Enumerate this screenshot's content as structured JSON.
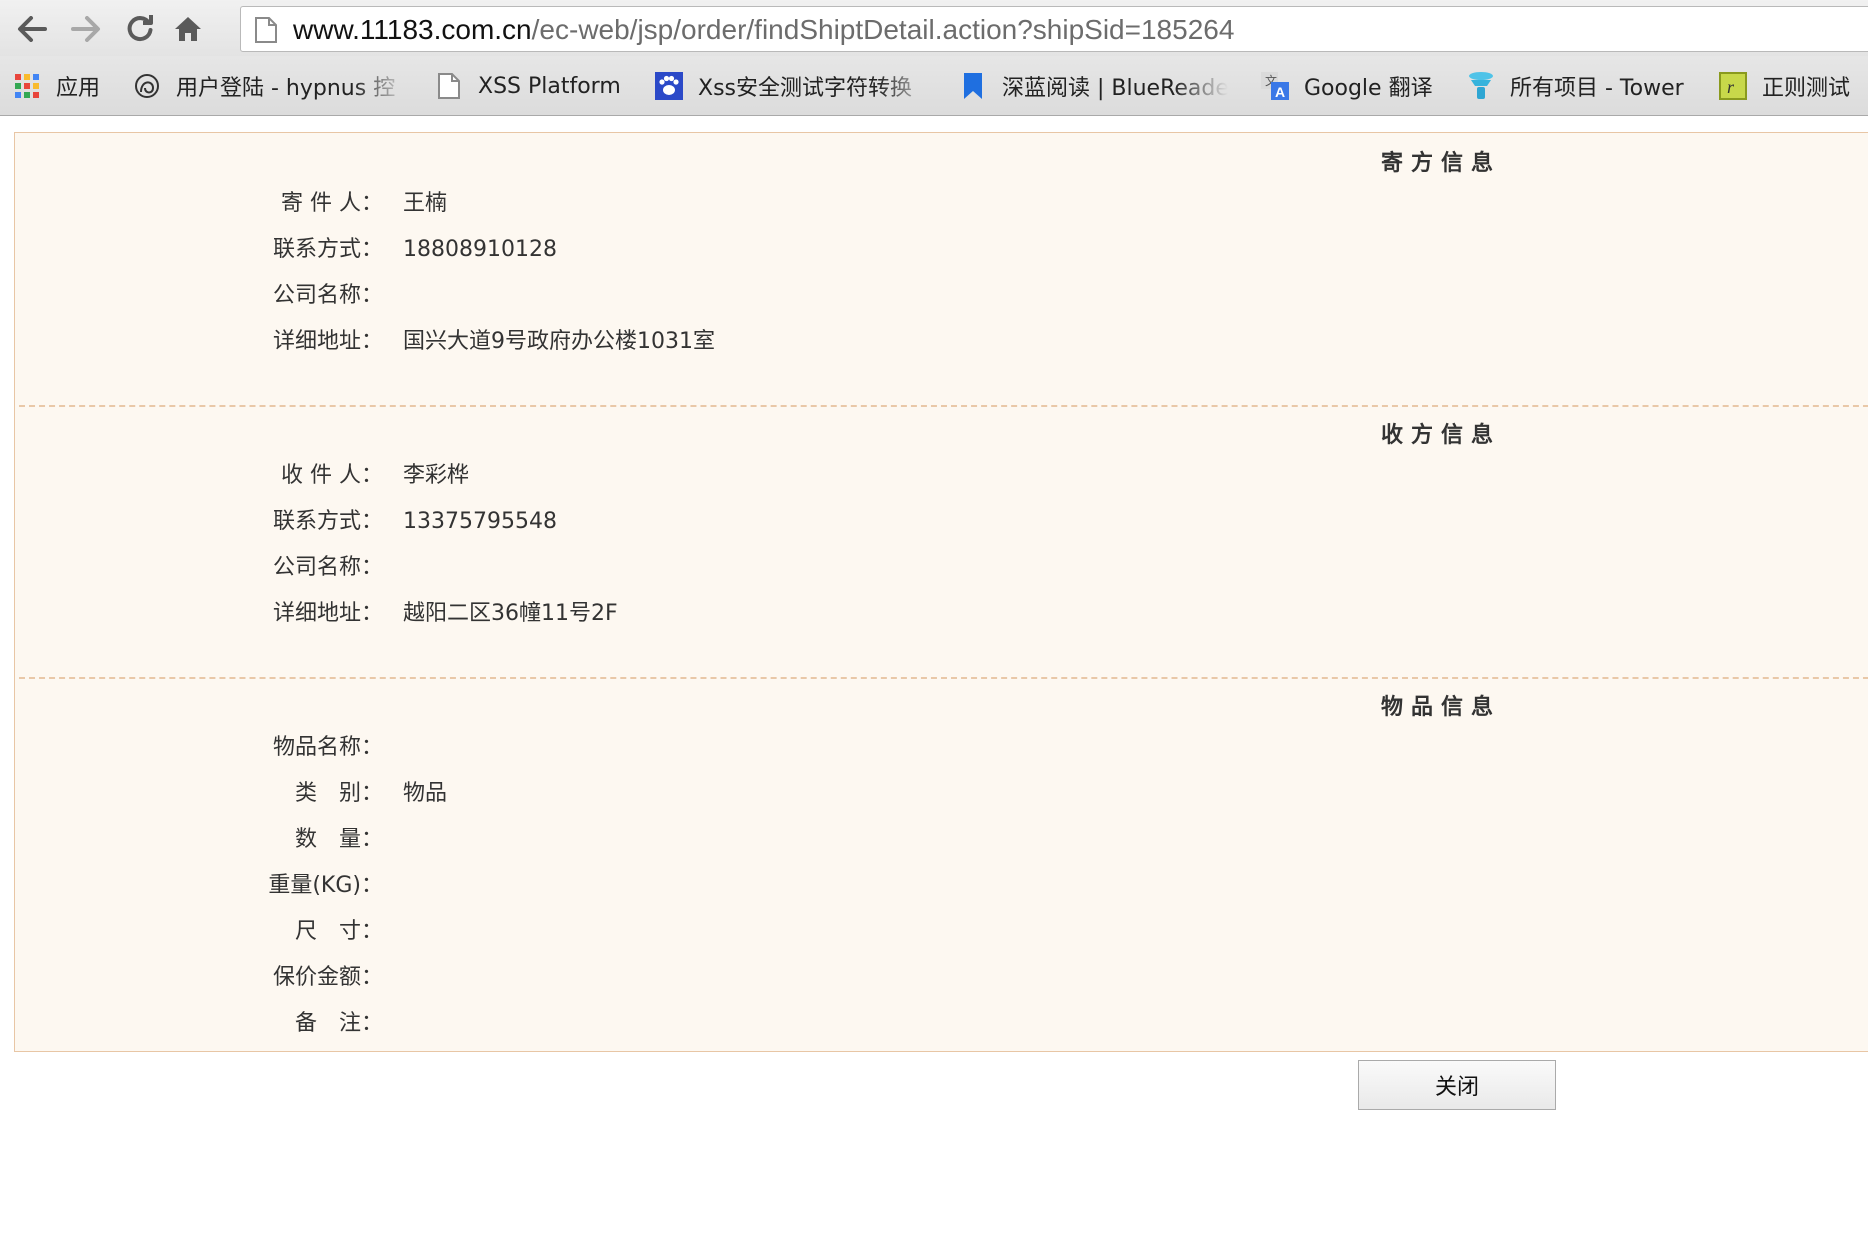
{
  "browser": {
    "url_host": "www.11183.com.cn",
    "url_path": "/ec-web/jsp/order/findShiptDetail.action?shipSid=185264"
  },
  "bookmarks": [
    {
      "label": "应用",
      "icon": "apps-grid-icon"
    },
    {
      "label": "用户登陆 - hypnus 控",
      "icon": "hypnus-logo-icon"
    },
    {
      "label": "XSS Platform",
      "icon": "blank-page-icon"
    },
    {
      "label": "Xss安全测试字符转换",
      "icon": "paw-icon"
    },
    {
      "label": "深蓝阅读 | BlueReade",
      "icon": "bookmark-ribbon-icon"
    },
    {
      "label": "Google 翻译",
      "icon": "translate-icon"
    },
    {
      "label": "所有项目 - Tower",
      "icon": "tower-icon"
    },
    {
      "label": "正则测试",
      "icon": "regex-icon"
    }
  ],
  "sender": {
    "title": "寄方信息",
    "fields": [
      {
        "label": "寄 件 人：",
        "value": "王楠"
      },
      {
        "label": "联系方式：",
        "value": "18808910128"
      },
      {
        "label": "公司名称：",
        "value": ""
      },
      {
        "label": "详细地址：",
        "value": "国兴大道9号政府办公楼1031室"
      }
    ]
  },
  "receiver": {
    "title": "收方信息",
    "fields": [
      {
        "label": "收 件 人：",
        "value": "李彩桦"
      },
      {
        "label": "联系方式：",
        "value": "13375795548"
      },
      {
        "label": "公司名称：",
        "value": ""
      },
      {
        "label": "详细地址：",
        "value": "越阳二区36幢11号2F"
      }
    ]
  },
  "goods": {
    "title": "物品信息",
    "fields": [
      {
        "label": "物品名称：",
        "value": ""
      },
      {
        "label": "类　别：",
        "value": "物品"
      },
      {
        "label": "数　量：",
        "value": ""
      },
      {
        "label": "重量(KG)：",
        "value": ""
      },
      {
        "label": "尺　寸：",
        "value": ""
      },
      {
        "label": "保价金额：",
        "value": ""
      },
      {
        "label": "备　注：",
        "value": ""
      }
    ]
  },
  "actions": {
    "close_label": "关闭"
  }
}
